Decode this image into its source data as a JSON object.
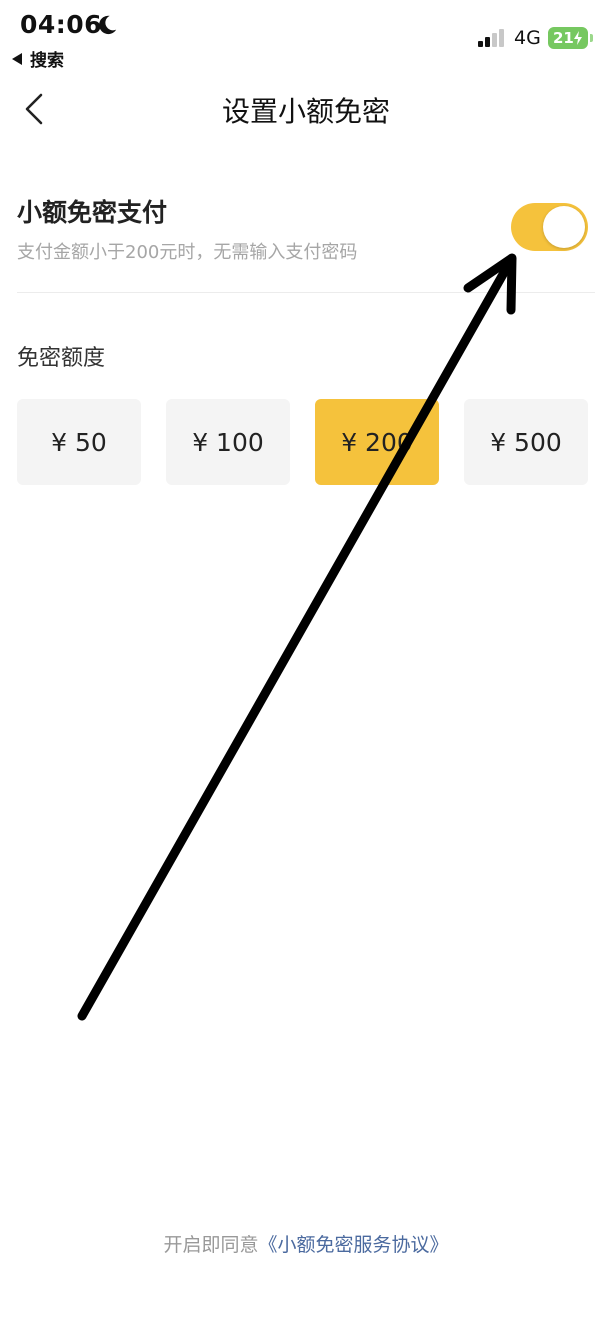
{
  "status": {
    "time": "04:06",
    "back_app": "搜索",
    "network": "4G",
    "battery": "21"
  },
  "nav": {
    "title": "设置小额免密"
  },
  "small_pay": {
    "title": "小额免密支付",
    "subtitle": "支付金额小于200元时，无需输入支付密码",
    "enabled": true
  },
  "limit": {
    "label": "免密额度",
    "options": [
      "¥ 50",
      "¥ 100",
      "¥ 200",
      "¥ 500"
    ],
    "selected": "¥ 200"
  },
  "footer": {
    "prefix": "开启即同意",
    "link": "《小额免密服务协议》"
  },
  "colors": {
    "accent": "#f5c23c",
    "link": "#4b6a9f",
    "battery": "#76c860"
  }
}
